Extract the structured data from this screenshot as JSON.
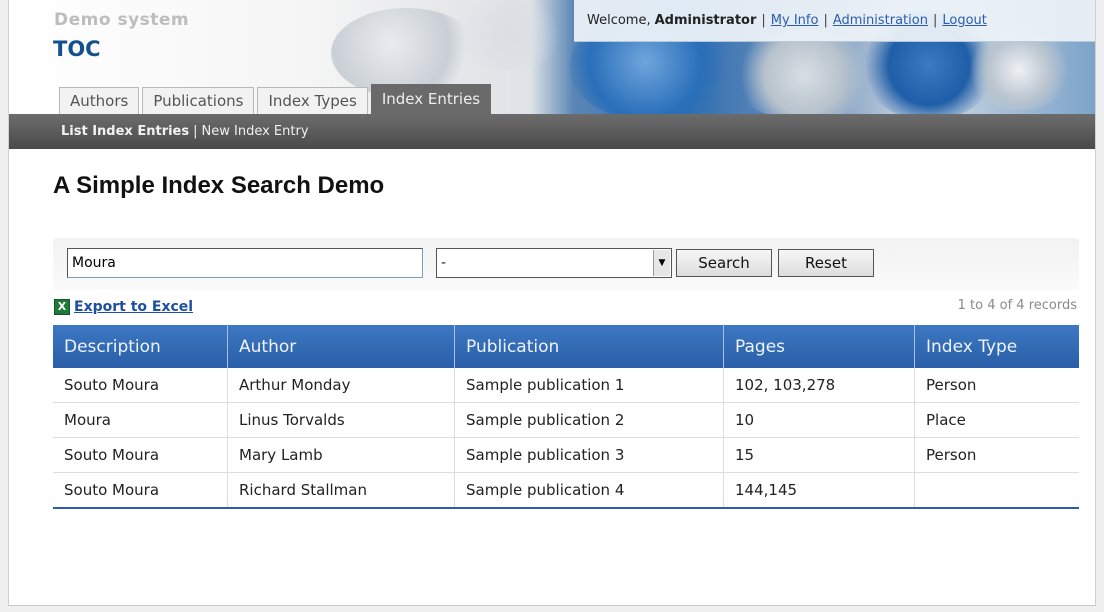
{
  "header": {
    "system_name": "Demo system",
    "app_name": "TOC"
  },
  "user_bar": {
    "welcome": "Welcome,",
    "user": "Administrator",
    "links": [
      "My Info",
      "Administration",
      "Logout"
    ]
  },
  "tabs": [
    {
      "label": "Authors",
      "active": false
    },
    {
      "label": "Publications",
      "active": false
    },
    {
      "label": "Index Types",
      "active": false
    },
    {
      "label": "Index Entries",
      "active": true
    }
  ],
  "subnav": {
    "current": "List Index Entries",
    "link": "New Index Entry"
  },
  "page_title": "A Simple Index Search Demo",
  "search": {
    "value": "Moura",
    "type_selected": "-",
    "search_label": "Search",
    "reset_label": "Reset"
  },
  "export": {
    "icon": "excel-icon",
    "label": "Export to Excel"
  },
  "record_count": "1 to 4 of 4 records",
  "table": {
    "columns": [
      "Description",
      "Author",
      "Publication",
      "Pages",
      "Index Type"
    ],
    "rows": [
      [
        "Souto Moura",
        "Arthur Monday",
        "Sample publication 1",
        "102, 103,278",
        "Person"
      ],
      [
        "Moura",
        "Linus Torvalds",
        "Sample publication 2",
        "10",
        "Place"
      ],
      [
        "Souto Moura",
        "Mary Lamb",
        "Sample publication 3",
        "15",
        "Person"
      ],
      [
        "Souto Moura",
        "Richard Stallman",
        "Sample publication 4",
        "144,145",
        ""
      ]
    ]
  }
}
